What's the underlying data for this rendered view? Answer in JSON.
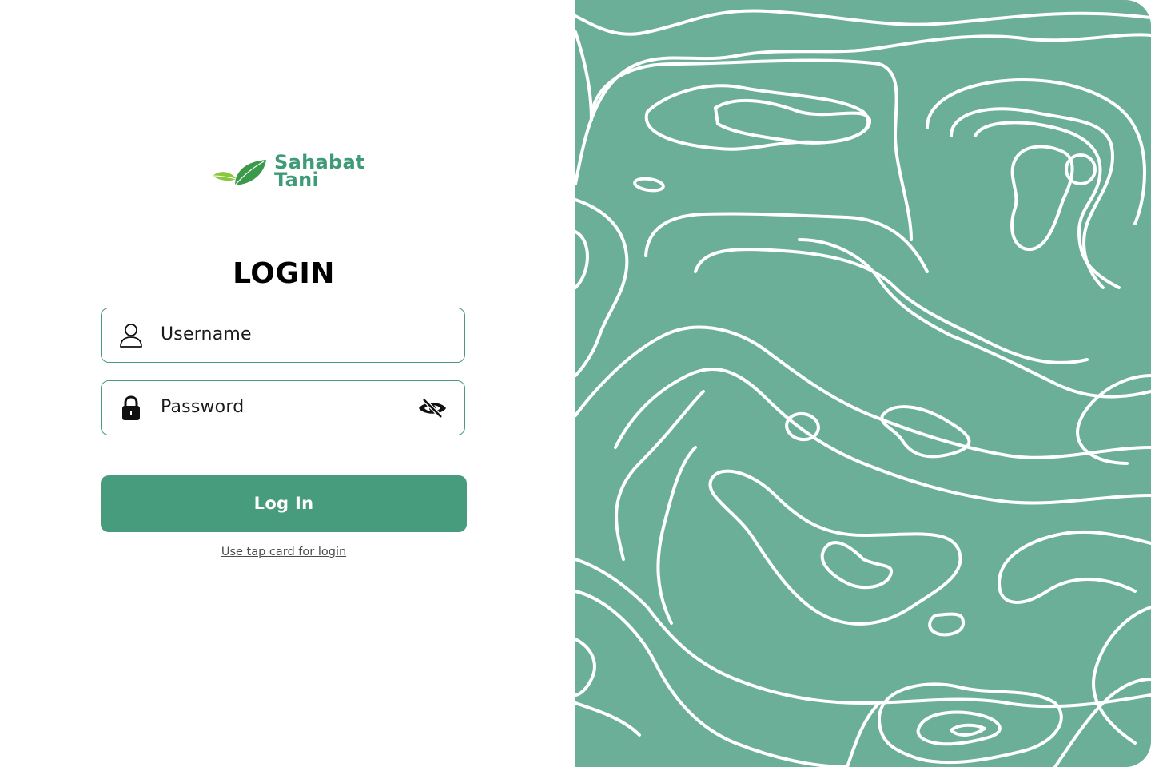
{
  "brand": {
    "line1": "Sahabat",
    "line2": "Tani",
    "logo_icon": "leaf-icon",
    "color": "#3f9a78"
  },
  "login": {
    "title": "LOGIN",
    "username": {
      "placeholder": "Username",
      "icon": "user-icon"
    },
    "password": {
      "placeholder": "Password",
      "icon": "lock-icon",
      "toggle_icon": "eye-slash-icon"
    },
    "submit_label": "Log In",
    "alt_link_label": "Use tap card for login"
  },
  "colors": {
    "accent": "#489c7e",
    "field_border": "#4a9a7e",
    "pattern_background": "#6caf98",
    "pattern_lines": "#ffffff"
  }
}
